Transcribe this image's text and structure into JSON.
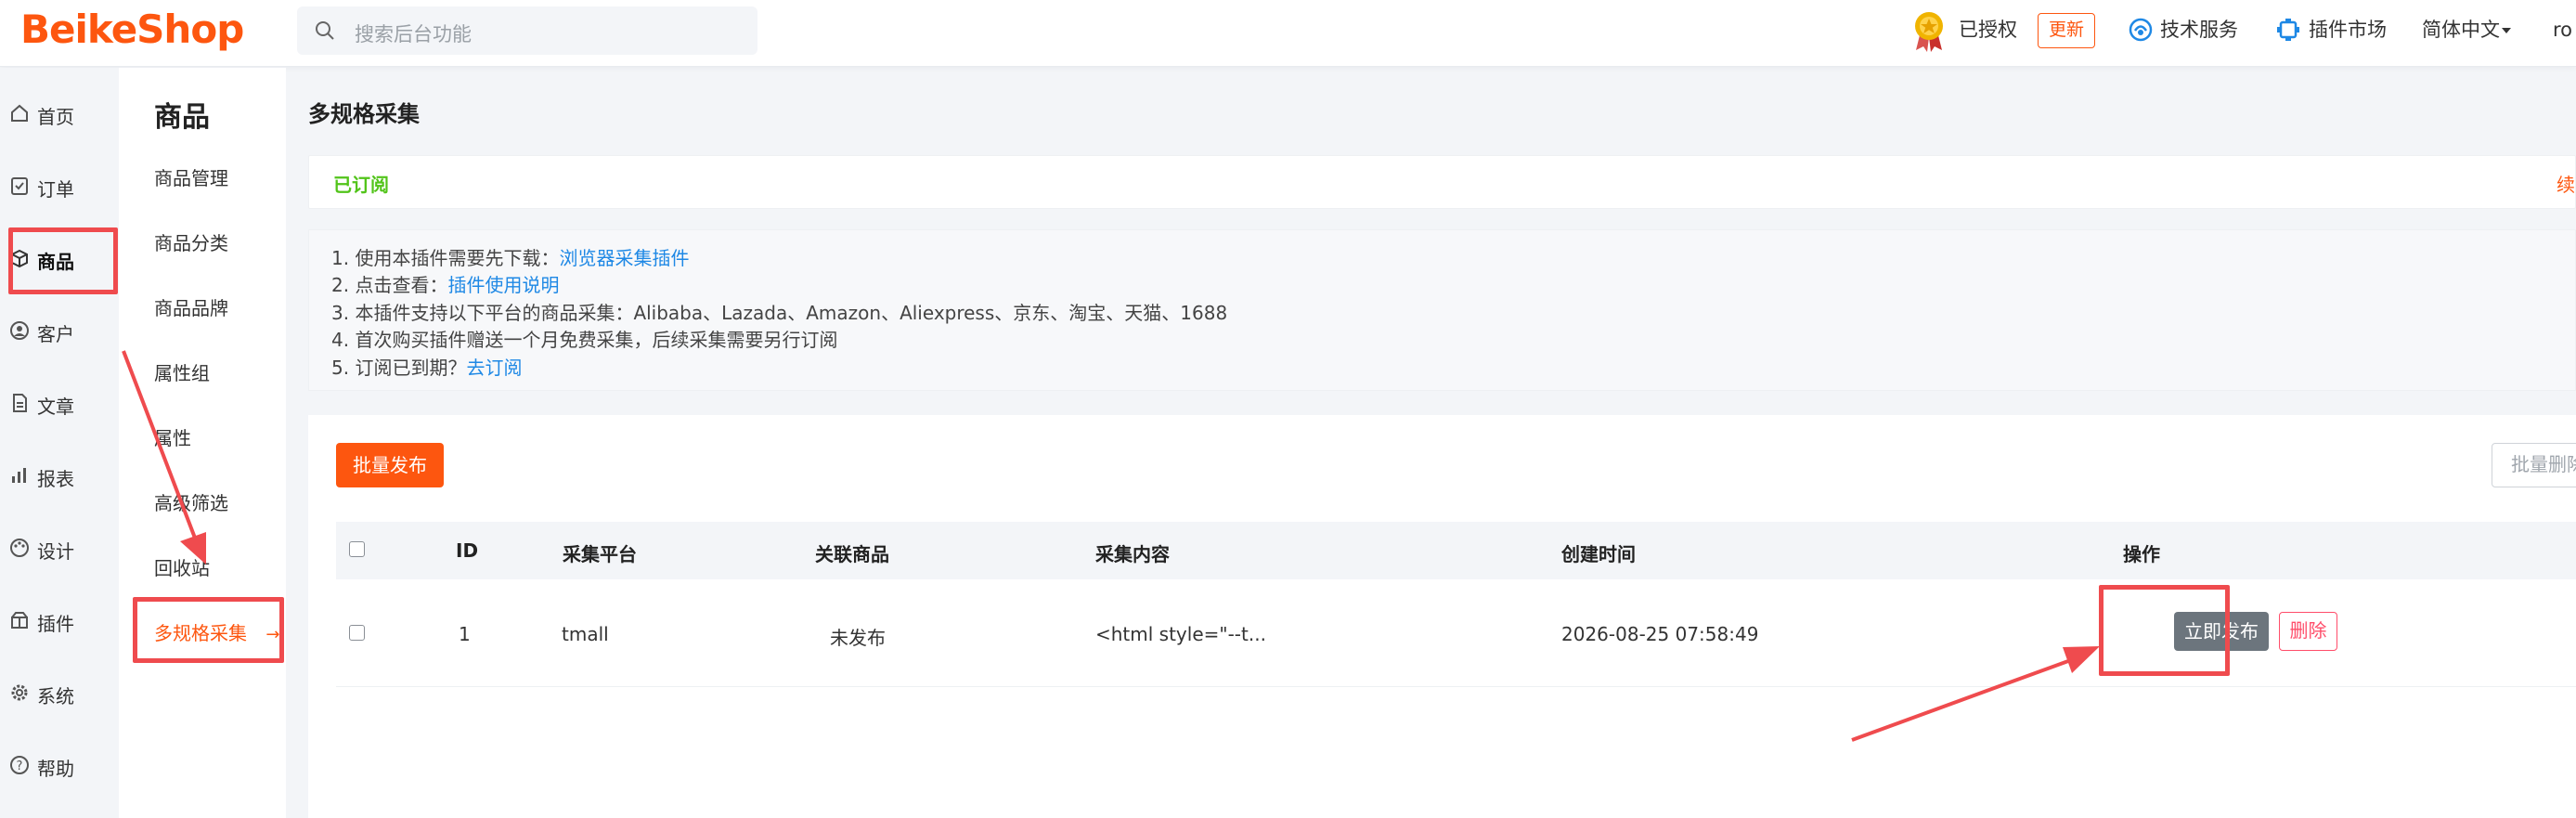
{
  "header": {
    "logo_text": "BeikeShop",
    "search_placeholder": "搜索后台功能",
    "licensed_label": "已授权",
    "update_label": "更新",
    "tech_service_label": "技术服务",
    "plugin_market_label": "插件市场",
    "language_label": "简体中文",
    "user_label": "ro"
  },
  "rail": {
    "items": [
      {
        "label": "首页",
        "icon": "home-icon"
      },
      {
        "label": "订单",
        "icon": "clipboard-icon"
      },
      {
        "label": "商品",
        "icon": "box-icon"
      },
      {
        "label": "客户",
        "icon": "user-circle-icon"
      },
      {
        "label": "文章",
        "icon": "document-icon"
      },
      {
        "label": "报表",
        "icon": "bar-chart-icon"
      },
      {
        "label": "设计",
        "icon": "palette-icon"
      },
      {
        "label": "插件",
        "icon": "plugin-icon"
      },
      {
        "label": "系统",
        "icon": "gear-icon"
      },
      {
        "label": "帮助",
        "icon": "help-icon"
      }
    ]
  },
  "submenu": {
    "title": "商品",
    "items": [
      {
        "label": "商品管理"
      },
      {
        "label": "商品分类"
      },
      {
        "label": "商品品牌"
      },
      {
        "label": "属性组"
      },
      {
        "label": "属性"
      },
      {
        "label": "高级筛选"
      },
      {
        "label": "回收站"
      },
      {
        "label": "多规格采集"
      }
    ]
  },
  "page": {
    "title": "多规格采集",
    "status": "已订阅",
    "renew_label": "续",
    "info": {
      "line1_text": "1. 使用本插件需要先下载：",
      "line1_link": "浏览器采集插件",
      "line2_text": "2. 点击查看：",
      "line2_link": "插件使用说明",
      "line3_text": "3. 本插件支持以下平台的商品采集：Alibaba、Lazada、Amazon、Aliexpress、京东、淘宝、天猫、1688",
      "line4_text": "4. 首次购买插件赠送一个月免费采集，后续采集需要另行订阅",
      "line5_text": "5. 订阅已到期？",
      "line5_link": "去订阅"
    },
    "batch_publish_label": "批量发布",
    "batch_delete_label": "批量删除"
  },
  "table": {
    "headers": [
      "ID",
      "采集平台",
      "关联商品",
      "采集内容",
      "创建时间",
      "操作"
    ],
    "rows": [
      {
        "id": "1",
        "platform": "tmall",
        "product": "未发布",
        "content": "<html style=\"--t...",
        "created": "2026-08-25 07:58:49",
        "publish_label": "立即发布",
        "delete_label": "删除"
      }
    ]
  },
  "colors": {
    "brand": "#fd560f",
    "annotation": "#ef4b4e",
    "success": "#52c41a",
    "link": "#1e88e5"
  }
}
